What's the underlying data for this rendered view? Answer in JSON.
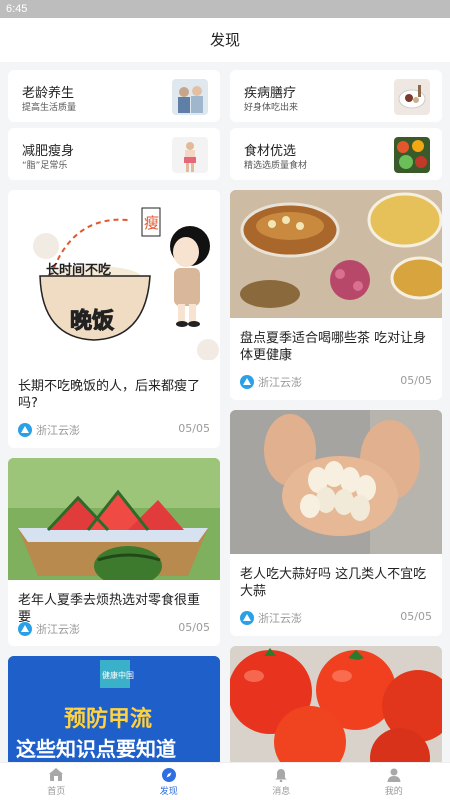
{
  "status": {
    "time": "6:45"
  },
  "header": {
    "title": "发现"
  },
  "categories": [
    {
      "title": "老龄养生",
      "subtitle": "提高生活质量"
    },
    {
      "title": "疾病膳疗",
      "subtitle": "好身体吃出来"
    },
    {
      "title": "减肥瘦身",
      "subtitle": "“脂”足常乐"
    },
    {
      "title": "食材优选",
      "subtitle": "精选选质量食材"
    }
  ],
  "articles": [
    {
      "title": "长期不吃晚饭的人，后来都瘦了吗?",
      "source": "浙江云澎",
      "date": "05/05",
      "image_text": {
        "a": "长时间不吃",
        "b": "晚饭",
        "c": "瘦"
      }
    },
    {
      "title": "盘点夏季适合喝哪些茶 吃对让身体更健康",
      "source": "浙江云澎",
      "date": "05/05"
    },
    {
      "title": "老年人夏季去烦热选对零食很重要",
      "source": "浙江云澎",
      "date": "05/05"
    },
    {
      "title": "老人吃大蒜好吗 这几类人不宜吃大蒜",
      "source": "浙江云澎",
      "date": "05/05"
    },
    {
      "title": "",
      "source": "",
      "date": "",
      "image_text": {
        "brand": "健康中国",
        "headline1": "预防甲流",
        "headline2": "这些知识点要知道"
      }
    },
    {
      "title": "",
      "source": "",
      "date": ""
    }
  ],
  "tabbar": [
    {
      "label": "首页",
      "icon": "home-icon"
    },
    {
      "label": "发现",
      "icon": "compass-icon"
    },
    {
      "label": "消息",
      "icon": "bell-icon"
    },
    {
      "label": "我的",
      "icon": "user-icon"
    }
  ],
  "colors": {
    "accent": "#2f6fe0",
    "source_logo": "#2aa0e8"
  }
}
